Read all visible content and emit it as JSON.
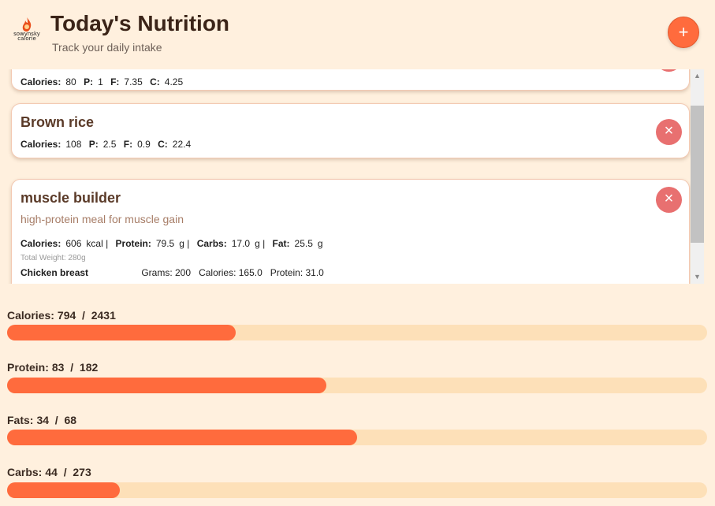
{
  "header": {
    "logo_text": "sowynsky calorie",
    "title": "Today's Nutrition",
    "subtitle": "Track your daily intake",
    "add_label": "+"
  },
  "colors": {
    "accent": "#ff6b3d",
    "delete": "#e87070",
    "track": "#fde0b8",
    "background": "#fff0de"
  },
  "entries": [
    {
      "name": "",
      "calories_label": "Calories:",
      "calories": "80",
      "p_label": "P:",
      "p": "1",
      "f_label": "F:",
      "f": "7.35",
      "c_label": "C:",
      "c": "4.25"
    },
    {
      "name": "Brown rice",
      "calories_label": "Calories:",
      "calories": "108",
      "p_label": "P:",
      "p": "2.5",
      "f_label": "F:",
      "f": "0.9",
      "c_label": "C:",
      "c": "22.4"
    },
    {
      "name": "muscle builder",
      "description": "high-protein meal for muscle gain",
      "calories_label": "Calories:",
      "calories": "606",
      "cal_unit": "kcal |",
      "protein_label": "Protein:",
      "protein": "79.5",
      "protein_unit": "g |",
      "carbs_label": "Carbs:",
      "carbs": "17.0",
      "carbs_unit": "g |",
      "fat_label": "Fat:",
      "fat": "25.5",
      "fat_unit": "g",
      "total_weight": "Total Weight: 280g",
      "ingredients": [
        {
          "name": "Chicken breast",
          "grams": "Grams: 200",
          "calories": "Calories: 165.0",
          "protein": "Protein: 31.0"
        }
      ]
    }
  ],
  "delete_glyph": "×",
  "summary": [
    {
      "label": "Calories:",
      "value": "794  /  2431",
      "progress": 0.327
    },
    {
      "label": "Protein:",
      "value": "83  /  182",
      "progress": 0.456
    },
    {
      "label": "Fats:",
      "value": "34  /  68",
      "progress": 0.5
    },
    {
      "label": "Carbs:",
      "value": "44  /  273",
      "progress": 0.161
    }
  ]
}
